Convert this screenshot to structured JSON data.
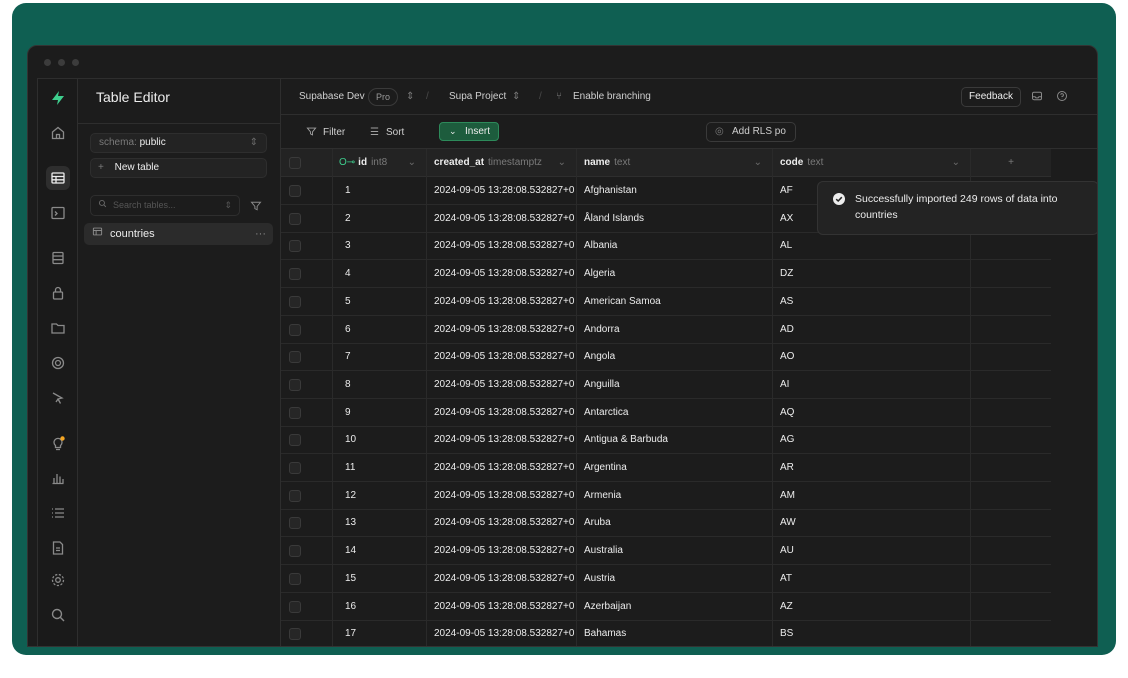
{
  "sidebar_title": "Table Editor",
  "schema": {
    "label": "schema:",
    "value": "public"
  },
  "new_table_label": "New table",
  "search_placeholder": "Search tables...",
  "tables": [
    {
      "name": "countries"
    }
  ],
  "topbar": {
    "org": "Supabase Dev",
    "plan": "Pro",
    "project": "Supa Project",
    "branching": "Enable branching",
    "feedback": "Feedback"
  },
  "toolbar": {
    "filter": "Filter",
    "sort": "Sort",
    "insert": "Insert",
    "rls": "Add RLS po"
  },
  "columns": [
    {
      "name": "id",
      "type": "int8"
    },
    {
      "name": "created_at",
      "type": "timestamptz"
    },
    {
      "name": "name",
      "type": "text"
    },
    {
      "name": "code",
      "type": "text"
    }
  ],
  "rows": [
    {
      "id": "1",
      "created_at": "2024-09-05 13:28:08.532827+0",
      "name": "Afghanistan",
      "code": "AF"
    },
    {
      "id": "2",
      "created_at": "2024-09-05 13:28:08.532827+0",
      "name": "Åland Islands",
      "code": "AX"
    },
    {
      "id": "3",
      "created_at": "2024-09-05 13:28:08.532827+0",
      "name": "Albania",
      "code": "AL"
    },
    {
      "id": "4",
      "created_at": "2024-09-05 13:28:08.532827+0",
      "name": "Algeria",
      "code": "DZ"
    },
    {
      "id": "5",
      "created_at": "2024-09-05 13:28:08.532827+0",
      "name": "American Samoa",
      "code": "AS"
    },
    {
      "id": "6",
      "created_at": "2024-09-05 13:28:08.532827+0",
      "name": "Andorra",
      "code": "AD"
    },
    {
      "id": "7",
      "created_at": "2024-09-05 13:28:08.532827+0",
      "name": "Angola",
      "code": "AO"
    },
    {
      "id": "8",
      "created_at": "2024-09-05 13:28:08.532827+0",
      "name": "Anguilla",
      "code": "AI"
    },
    {
      "id": "9",
      "created_at": "2024-09-05 13:28:08.532827+0",
      "name": "Antarctica",
      "code": "AQ"
    },
    {
      "id": "10",
      "created_at": "2024-09-05 13:28:08.532827+0",
      "name": "Antigua & Barbuda",
      "code": "AG"
    },
    {
      "id": "11",
      "created_at": "2024-09-05 13:28:08.532827+0",
      "name": "Argentina",
      "code": "AR"
    },
    {
      "id": "12",
      "created_at": "2024-09-05 13:28:08.532827+0",
      "name": "Armenia",
      "code": "AM"
    },
    {
      "id": "13",
      "created_at": "2024-09-05 13:28:08.532827+0",
      "name": "Aruba",
      "code": "AW"
    },
    {
      "id": "14",
      "created_at": "2024-09-05 13:28:08.532827+0",
      "name": "Australia",
      "code": "AU"
    },
    {
      "id": "15",
      "created_at": "2024-09-05 13:28:08.532827+0",
      "name": "Austria",
      "code": "AT"
    },
    {
      "id": "16",
      "created_at": "2024-09-05 13:28:08.532827+0",
      "name": "Azerbaijan",
      "code": "AZ"
    },
    {
      "id": "17",
      "created_at": "2024-09-05 13:28:08.532827+0",
      "name": "Bahamas",
      "code": "BS"
    }
  ],
  "toast": {
    "message": "Successfully imported 249 rows of data into countries"
  },
  "colors": {
    "frame": "#0f5f52",
    "background": "#1c1c1c",
    "brand": "#3ecf8e",
    "insert": "#1d5c3d",
    "notice_dot": "#f5a623"
  },
  "icons": [
    "logo-icon",
    "home-icon",
    "table-editor-icon",
    "sql-editor-icon",
    "database-icon",
    "auth-icon",
    "storage-icon",
    "realtime-icon",
    "edge-functions-icon",
    "advisors-icon",
    "reports-icon",
    "logs-icon",
    "docs-icon",
    "settings-icon",
    "search-icon"
  ]
}
